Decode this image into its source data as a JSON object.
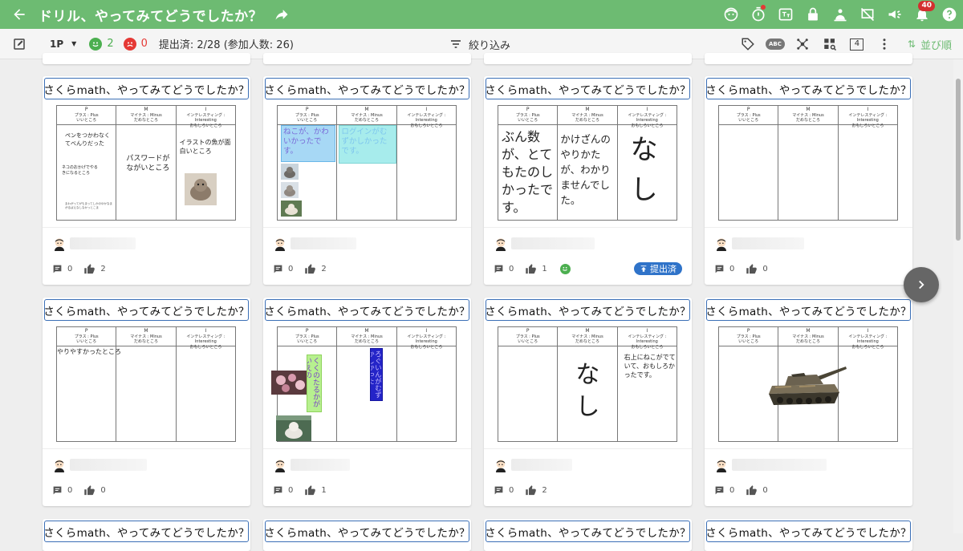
{
  "appbar": {
    "title": "ドリル、やってみてどうでしたか？",
    "notification_count": "40",
    "color": "#6dbb72"
  },
  "toolbar": {
    "page_label": "1P",
    "good_count": "2",
    "bad_count": "0",
    "submitted_text": "提出済: 2/28 (参加人数: 26)",
    "filter_label": "絞り込み",
    "sort_label": "並び順",
    "number_box": "4",
    "abc_label": "ABC"
  },
  "sheet_header": {
    "p": "P",
    "p_sub1": "プラス : Plus",
    "p_sub2": "いいところ",
    "m": "M",
    "m_sub1": "マイナス : Minus",
    "m_sub2": "だめなところ",
    "i": "I",
    "i_sub1": "インテレスティング : Interesting",
    "i_sub2": "おもしろいところ"
  },
  "submitted_badge": "提出済",
  "cards": [
    {
      "title": "さくらmath、やってみてどうでしたか？",
      "comments": "0",
      "likes": "2",
      "p1": "ペンをつかわなくてべんりだった",
      "p2": "ネコのおかげでやるきになるところ",
      "p3": "まわがってがもまってしかのゆかなまがるぱえなしなかっとこま",
      "m": "パスワードがながいところ",
      "i": "イラストの魚が面白いところ"
    },
    {
      "title": "さくらmath、やってみてどうでしたか？",
      "comments": "0",
      "likes": "2",
      "p": "ねこが、かわいかったです。",
      "m": "ログインがむずかしかったです。"
    },
    {
      "title": "さくらmath、やってみてどうでしたか？",
      "comments": "0",
      "likes": "1",
      "p": "ぶん数が、とてもたのしかったです。",
      "m": "かけざんのやりかたが、わかりませんでした。",
      "i": "なし"
    },
    {
      "title": "さくらmath、やってみてどうでしたか？",
      "comments": "0",
      "likes": "0"
    },
    {
      "title": "さくらmath、やってみてどうでしたか？",
      "comments": "0",
      "likes": "0",
      "p": "やりやすかったところ"
    },
    {
      "title": "さくらmath、やってみてどうでしたか？",
      "comments": "0",
      "likes": "1",
      "p": "くくのたるかがいえの",
      "m": "ろぐいんがむずかしかった"
    },
    {
      "title": "さくらmath、やってみてどうでしたか？",
      "comments": "0",
      "likes": "2",
      "m": "なし",
      "i": "右上にねこがでていて、おもしろかったです。"
    },
    {
      "title": "さくらmath、やってみてどうでしたか？",
      "comments": "0",
      "likes": "0"
    },
    {
      "title": "さくらmath、やってみてどうでしたか？"
    },
    {
      "title": "さくらmath、やってみてどうでしたか？"
    },
    {
      "title": "さくらmath、やってみてどうでしたか？"
    },
    {
      "title": "さくらmath、やってみてどうでしたか？"
    }
  ]
}
